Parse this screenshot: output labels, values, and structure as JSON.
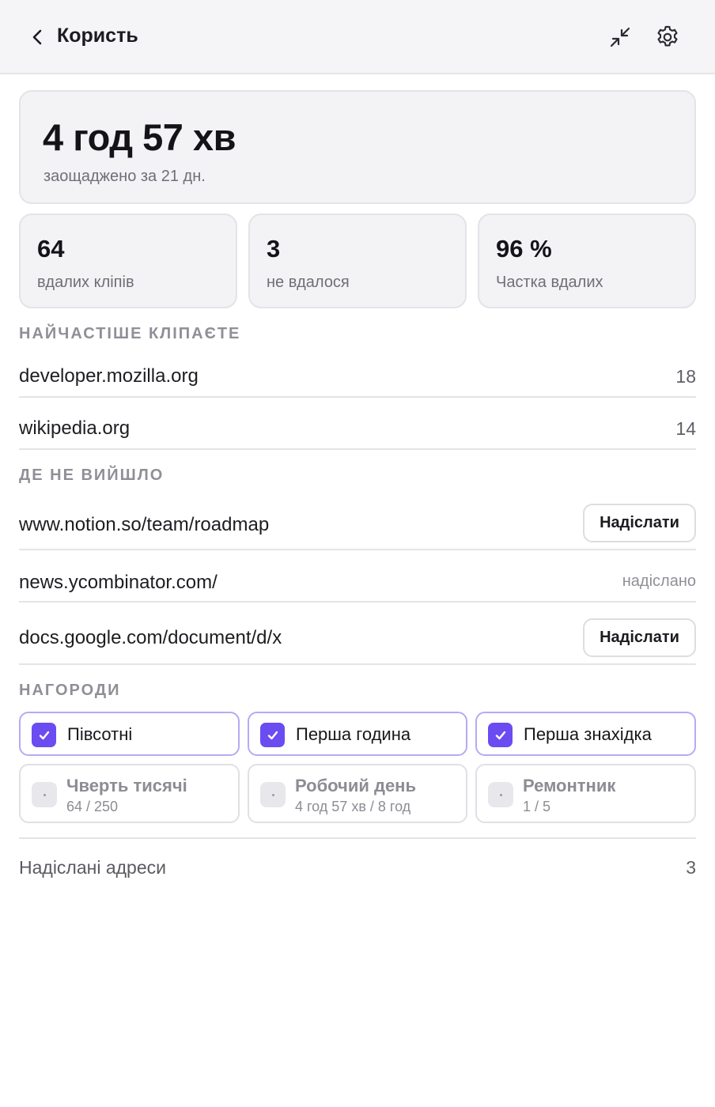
{
  "header": {
    "title": "Користь",
    "back_icon": "chevron-left-icon",
    "collapse_icon": "collapse-arrows-icon",
    "settings_icon": "gear-icon"
  },
  "hero": {
    "value": "4 год 57 хв",
    "subtitle": "заощаджено за 21 дн."
  },
  "stats": [
    {
      "value": "64",
      "label": "вдалих кліпів"
    },
    {
      "value": "3",
      "label": "не вдалося"
    },
    {
      "value": "96 %",
      "label": "Частка вдалих"
    }
  ],
  "top_sites": {
    "heading": "НАЙЧАСТІШЕ КЛІПАЄТЕ",
    "items": [
      {
        "site": "developer.mozilla.org",
        "count": "18"
      },
      {
        "site": "wikipedia.org",
        "count": "14"
      }
    ]
  },
  "failures": {
    "heading": "ДЕ НЕ ВИЙШЛО",
    "items": [
      {
        "url": "www.notion.so/team/roadmap",
        "action": "Надіслати"
      },
      {
        "url": "news.ycombinator.com/",
        "status": "надіслано"
      },
      {
        "url": "docs.google.com/document/d/x",
        "action": "Надіслати"
      }
    ]
  },
  "awards": {
    "heading": "НАГОРОДИ",
    "earned": [
      {
        "label": "Півсотні"
      },
      {
        "label": "Перша година"
      },
      {
        "label": "Перша знахідка"
      }
    ],
    "locked": [
      {
        "label": "Чверть тисячі",
        "progress": "64 / 250"
      },
      {
        "label": "Робочий день",
        "progress": "4 год 57 хв / 8 год"
      },
      {
        "label": "Ремонтник",
        "progress": "1 / 5"
      }
    ]
  },
  "footer": {
    "label": "Надіслані адреси",
    "count": "3"
  },
  "colors": {
    "accent": "#6a4cf1",
    "earned_border": "#b6aaf3",
    "card_bg": "#f3f3f6"
  }
}
